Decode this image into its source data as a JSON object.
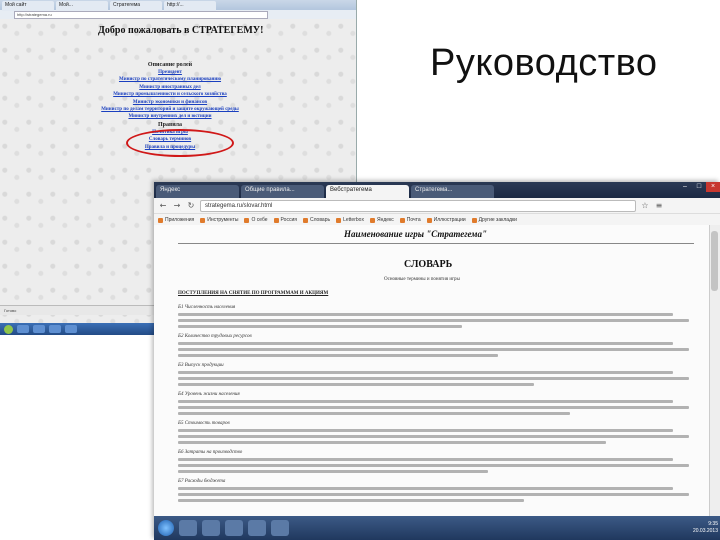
{
  "slide": {
    "title": "Руководство"
  },
  "back_window": {
    "tabs": [
      "Мой сайт",
      "Мой...",
      "Стратегема",
      "http://..."
    ],
    "address": "http://strategema.ru",
    "heading": "Добро пожаловать в СТРАТЕГЕМУ!",
    "section_1": "Описание ролей",
    "links": [
      "Президент",
      "Министр по стратегическому планированию",
      "Министр иностранных дел",
      "Министр промышленности и сельского хозяйства",
      "Министр экономики и финансов",
      "Министр по делам территорий и защите окружающей среды",
      "Министр внутренних дел и юстиции"
    ],
    "section_2": "Правила",
    "highlighted_links": [
      "Политика игры",
      "Словарь терминов"
    ],
    "last_link": "Правила и процедуры",
    "status": "Готово"
  },
  "front_window": {
    "tabs": [
      "Яндекс",
      "Общие правила...",
      "Вебстратегема",
      "Стратегема..."
    ],
    "window_controls": {
      "minimize": "–",
      "maximize": "□",
      "close": "×"
    },
    "url": "strategema.ru/slovar.html",
    "bookmarks": [
      "Приложения",
      "Инструменты",
      "О себе",
      "Россия",
      "Словарь",
      "Letterbox",
      "Яндекс",
      "Почта",
      "Иллюстрации",
      "Другие закладки"
    ],
    "doc_title": "Наименование игры \"Стратегема\"",
    "dictionary_title": "СЛОВАРЬ",
    "dictionary_subtitle": "Основные термины и понятия игры",
    "intro_link": "ПОСТУПЛЕНИЯ НА СНЯТИЕ ПО ПРОГРАММАМ И АКЦИЯМ",
    "sections": [
      {
        "heading": "Б1 Численность населения",
        "lines": 3
      },
      {
        "heading": "Б2 Количество трудовых ресурсов",
        "lines": 3
      },
      {
        "heading": "Б3 Выпуск продукции",
        "lines": 3
      },
      {
        "heading": "Б4 Уровень жизни населения",
        "lines": 3
      },
      {
        "heading": "Б5 Стоимость товаров",
        "lines": 3
      },
      {
        "heading": "Б6 Затраты на производство",
        "lines": 3
      },
      {
        "heading": "Б7 Расходы бюджета",
        "lines": 3
      }
    ],
    "clock": {
      "time": "9:35",
      "date": "20.03.2013"
    }
  }
}
